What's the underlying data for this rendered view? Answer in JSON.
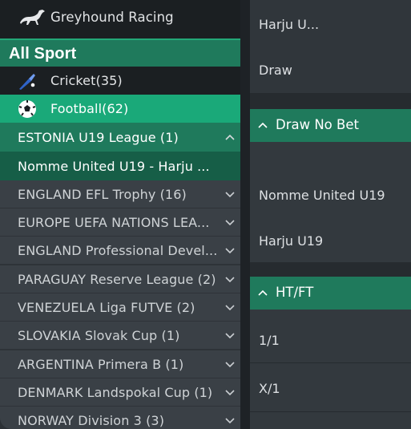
{
  "sidebar": {
    "greyhound": {
      "label": "Greyhound Racing",
      "icon": "greyhound-icon"
    },
    "all_sport": "All Sport",
    "cricket": {
      "label": "Cricket(35)",
      "icon": "cricket-icon"
    },
    "football": {
      "label": "Football(62)",
      "icon": "football-icon"
    },
    "open_league": {
      "label": "ESTONIA U19 League (1)",
      "icon": "chevron-up-icon"
    },
    "open_match": "Nomme United U19 - Harju ...",
    "leagues": [
      {
        "label": "ENGLAND EFL Trophy (16)"
      },
      {
        "label": "EUROPE UEFA NATIONS LEA..."
      },
      {
        "label": "ENGLAND Professional Devel..."
      },
      {
        "label": "PARAGUAY Reserve League (2)"
      },
      {
        "label": "VENEZUELA Liga FUTVE (2)"
      },
      {
        "label": "SLOVAKIA Slovak Cup (1)"
      },
      {
        "label": "ARGENTINA Primera B (1)"
      },
      {
        "label": "DENMARK Landspokal Cup (1)"
      },
      {
        "label": "NORWAY Division 3 (3)"
      }
    ]
  },
  "main": {
    "top_items": [
      "Harju U...",
      "Draw"
    ],
    "draw_no_bet": {
      "title": "Draw No Bet",
      "items": [
        "Nomme United U19",
        "Harju U19"
      ]
    },
    "ht_ft": {
      "title": "HT/FT",
      "items": [
        "1/1",
        "X/1"
      ]
    }
  },
  "colors": {
    "accent_green": "#1aa979",
    "dark_green": "#1f7a5c",
    "sidebar_bg": "#2e3338",
    "league_row_bg": "#3a4046"
  }
}
